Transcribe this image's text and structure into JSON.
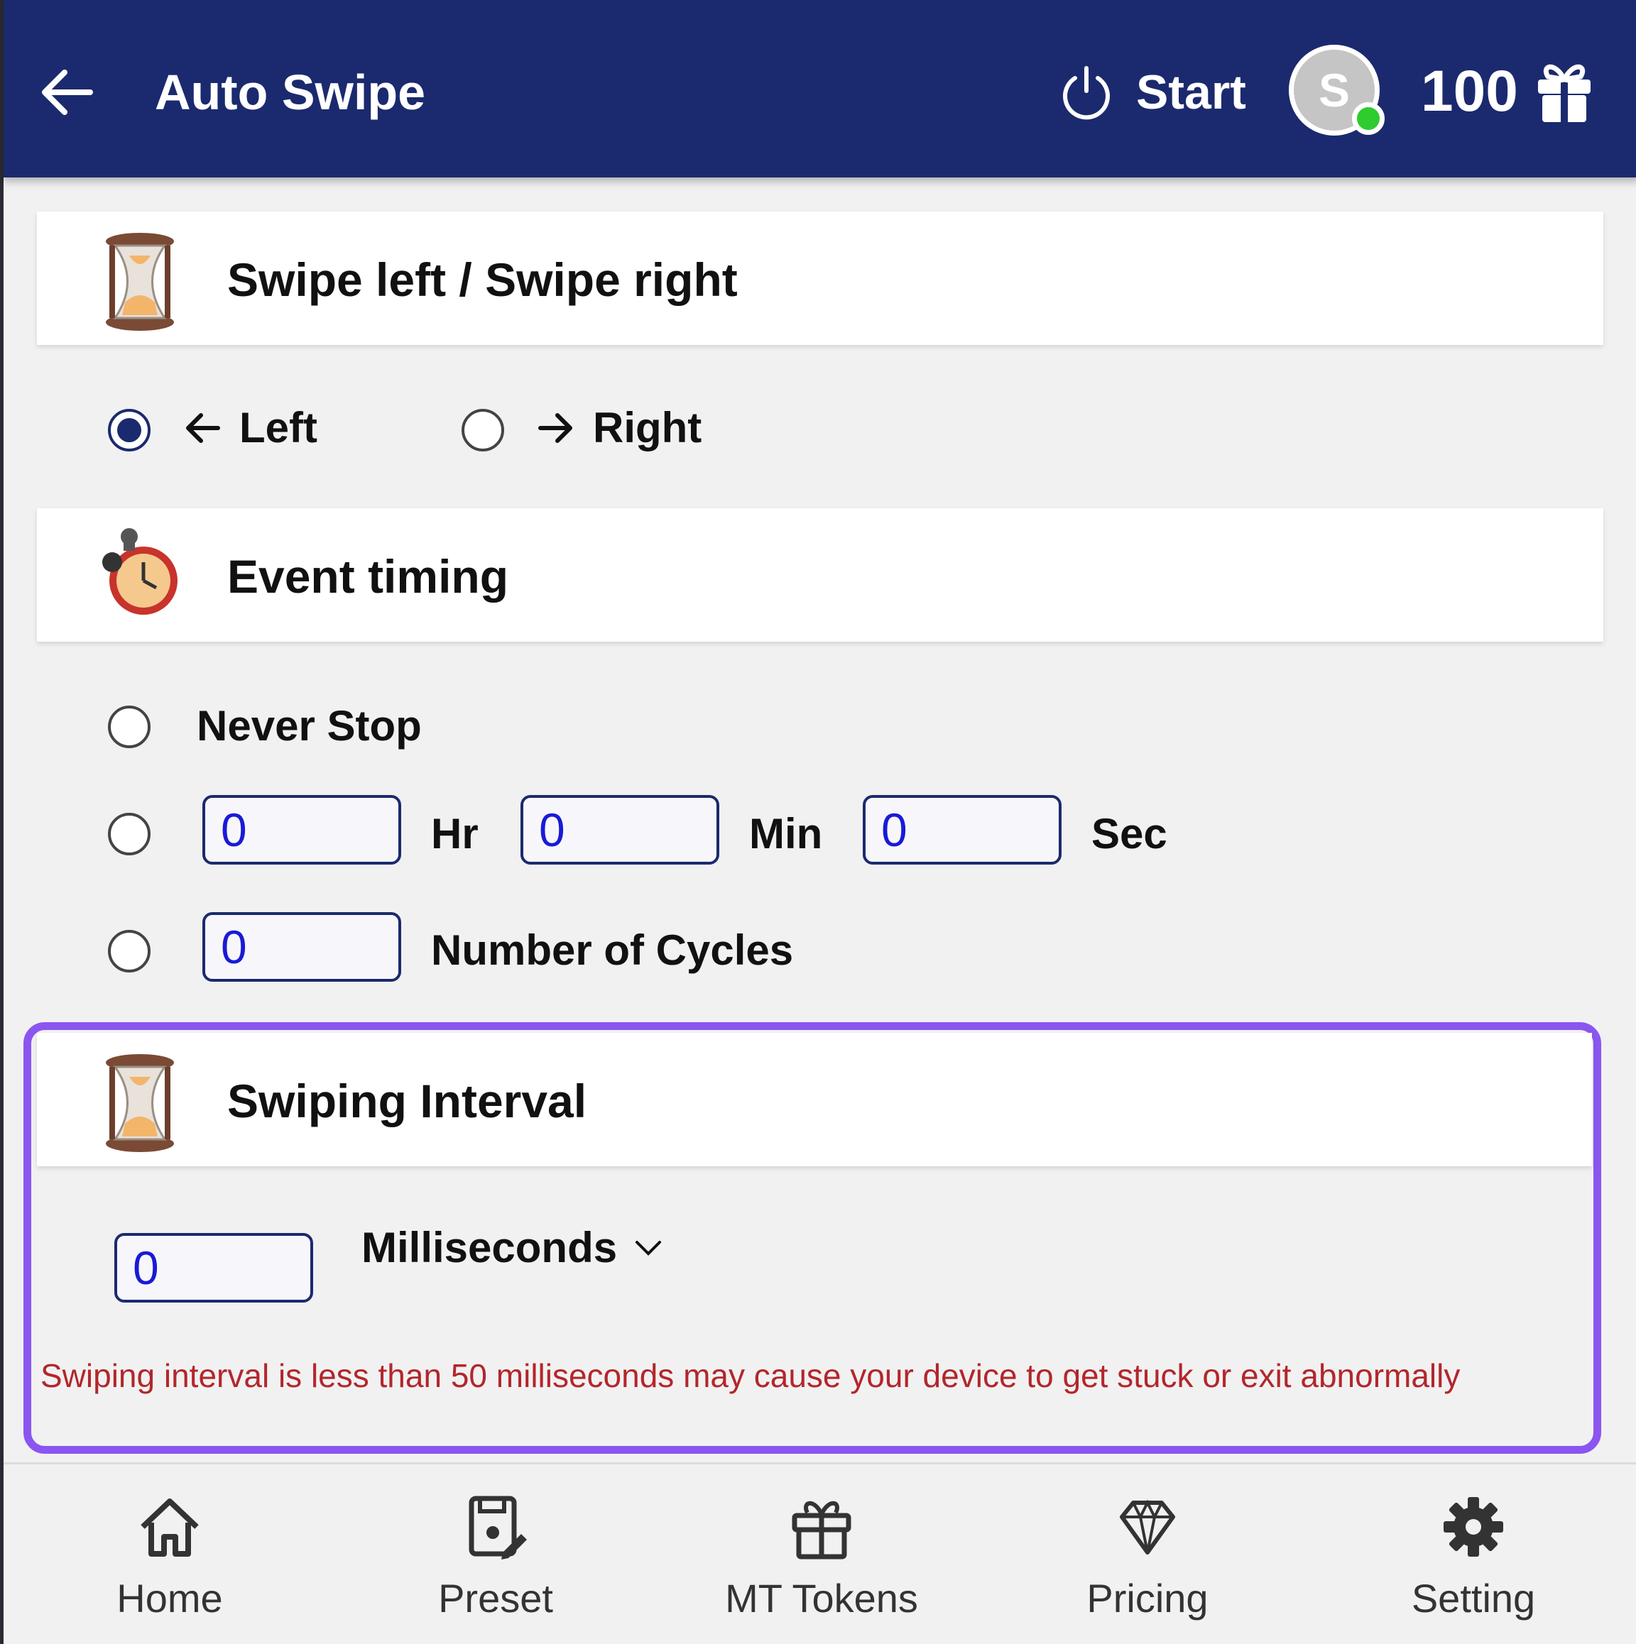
{
  "header": {
    "back_icon": "arrow-left-icon",
    "title": "Auto Swipe",
    "start_label": "Start",
    "power_icon": "power-icon",
    "avatar_initial": "S",
    "token_count": "100",
    "gift_icon": "gift-icon",
    "background_color": "#1b2a6e"
  },
  "swipe_direction": {
    "heading": "Swipe left / Swipe right",
    "icon": "hourglass-icon",
    "options": [
      {
        "label": "Left",
        "arrow_icon": "arrow-left-icon",
        "selected": true
      },
      {
        "label": "Right",
        "arrow_icon": "arrow-right-icon",
        "selected": false
      }
    ]
  },
  "event_timing": {
    "heading": "Event timing",
    "icon": "alarm-clock-icon",
    "never_stop_label": "Never Stop",
    "hours_value": "0",
    "hours_label": "Hr",
    "minutes_value": "0",
    "minutes_label": "Min",
    "seconds_value": "0",
    "seconds_label": "Sec",
    "cycles_value": "0",
    "cycles_label": "Number of Cycles"
  },
  "swiping_interval": {
    "heading": "Swiping Interval",
    "icon": "hourglass-icon",
    "value": "0",
    "unit": "Milliseconds",
    "warning": "Swiping interval is less than 50 milliseconds may cause your device to get stuck or exit abnormally",
    "highlight_color": "#8b55f0",
    "warning_color": "#b3262b"
  },
  "bottom_nav": {
    "items": [
      {
        "label": "Home",
        "icon": "home-icon"
      },
      {
        "label": "Preset",
        "icon": "preset-icon"
      },
      {
        "label": "MT Tokens",
        "icon": "gift-icon"
      },
      {
        "label": "Pricing",
        "icon": "diamond-icon"
      },
      {
        "label": "Setting",
        "icon": "gear-icon"
      }
    ]
  }
}
